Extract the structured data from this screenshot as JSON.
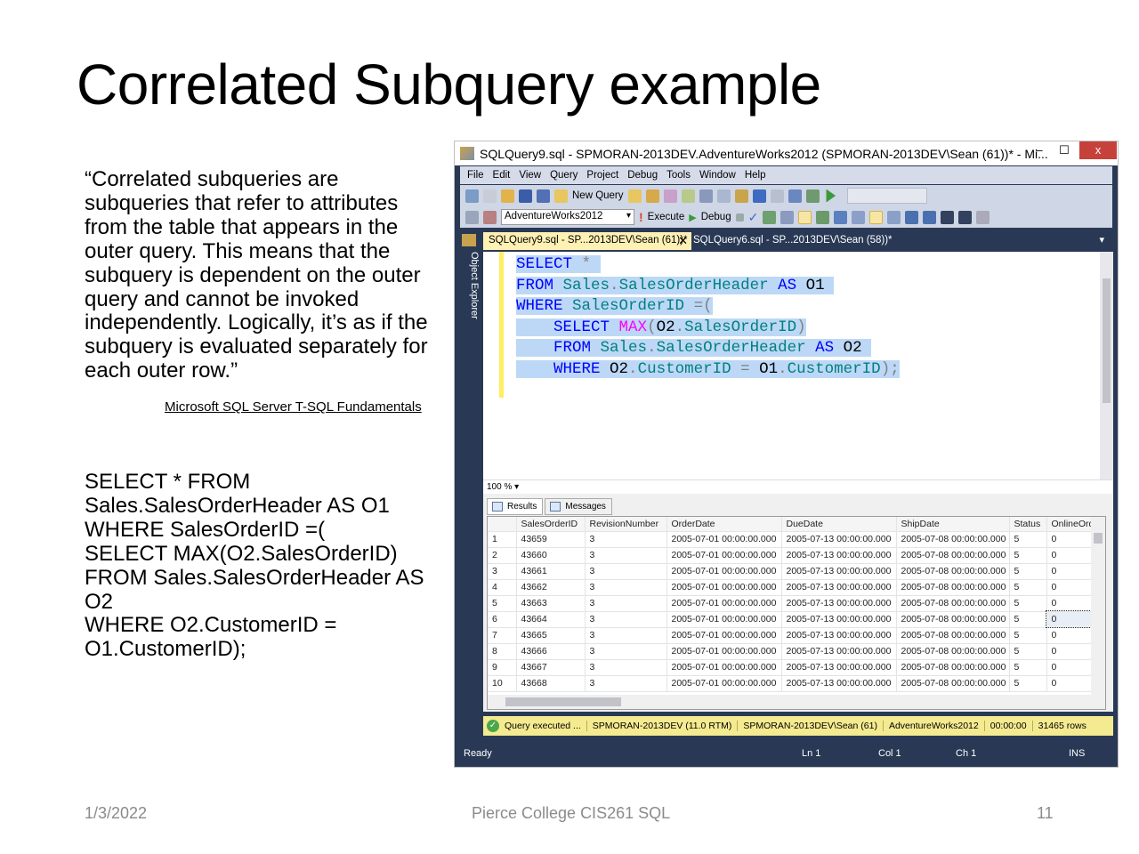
{
  "slide": {
    "title": "Correlated Subquery example",
    "quote": "“Correlated subqueries are subqueries that refer to attributes from the table that appears in the outer query. This means that the subquery is dependent on the outer query and cannot be invoked independently. Logically, it’s as if the subquery is evaluated separately for each outer row.”",
    "attribution": "Microsoft SQL Server T-SQL Fundamentals",
    "sql_lines": [
      "SELECT * FROM",
      "Sales.SalesOrderHeader AS O1",
      "WHERE SalesOrderID =(",
      "SELECT MAX(O2.SalesOrderID)",
      "FROM Sales.SalesOrderHeader AS",
      "O2",
      "WHERE O2.CustomerID =",
      "O1.CustomerID);"
    ],
    "footer": {
      "date": "1/3/2022",
      "center": "Pierce College CIS261 SQL",
      "page": "11"
    }
  },
  "ssms": {
    "window_title": "SQLQuery9.sql - SPMORAN-2013DEV.AdventureWorks2012 (SPMORAN-2013DEV\\Sean (61))* - Mi...",
    "window_buttons": {
      "minimize": "–",
      "maximize": "☐",
      "close": "x"
    },
    "menu": [
      "File",
      "Edit",
      "View",
      "Query",
      "Project",
      "Debug",
      "Tools",
      "Window",
      "Help"
    ],
    "toolbar": {
      "new_query": "New Query",
      "database": "AdventureWorks2012",
      "execute": "Execute",
      "debug": "Debug"
    },
    "object_explorer": "Object Explorer",
    "tabs": [
      {
        "label": "SQLQuery9.sql - SP...2013DEV\\Sean (61))*",
        "active": true
      },
      {
        "label": "SQLQuery6.sql - SP...2013DEV\\Sean (58))*",
        "active": false
      }
    ],
    "zoom": "100 %",
    "result_tabs": [
      "Results",
      "Messages"
    ],
    "columns": [
      "",
      "SalesOrderID",
      "RevisionNumber",
      "OrderDate",
      "DueDate",
      "ShipDate",
      "Status",
      "OnlineOrd"
    ],
    "rows": [
      [
        "1",
        "43659",
        "3",
        "2005-07-01 00:00:00.000",
        "2005-07-13 00:00:00.000",
        "2005-07-08 00:00:00.000",
        "5",
        "0"
      ],
      [
        "2",
        "43660",
        "3",
        "2005-07-01 00:00:00.000",
        "2005-07-13 00:00:00.000",
        "2005-07-08 00:00:00.000",
        "5",
        "0"
      ],
      [
        "3",
        "43661",
        "3",
        "2005-07-01 00:00:00.000",
        "2005-07-13 00:00:00.000",
        "2005-07-08 00:00:00.000",
        "5",
        "0"
      ],
      [
        "4",
        "43662",
        "3",
        "2005-07-01 00:00:00.000",
        "2005-07-13 00:00:00.000",
        "2005-07-08 00:00:00.000",
        "5",
        "0"
      ],
      [
        "5",
        "43663",
        "3",
        "2005-07-01 00:00:00.000",
        "2005-07-13 00:00:00.000",
        "2005-07-08 00:00:00.000",
        "5",
        "0"
      ],
      [
        "6",
        "43664",
        "3",
        "2005-07-01 00:00:00.000",
        "2005-07-13 00:00:00.000",
        "2005-07-08 00:00:00.000",
        "5",
        "0"
      ],
      [
        "7",
        "43665",
        "3",
        "2005-07-01 00:00:00.000",
        "2005-07-13 00:00:00.000",
        "2005-07-08 00:00:00.000",
        "5",
        "0"
      ],
      [
        "8",
        "43666",
        "3",
        "2005-07-01 00:00:00.000",
        "2005-07-13 00:00:00.000",
        "2005-07-08 00:00:00.000",
        "5",
        "0"
      ],
      [
        "9",
        "43667",
        "3",
        "2005-07-01 00:00:00.000",
        "2005-07-13 00:00:00.000",
        "2005-07-08 00:00:00.000",
        "5",
        "0"
      ],
      [
        "10",
        "43668",
        "3",
        "2005-07-01 00:00:00.000",
        "2005-07-13 00:00:00.000",
        "2005-07-08 00:00:00.000",
        "5",
        "0"
      ]
    ],
    "query_status": {
      "message": "Query executed ...",
      "server": "SPMORAN-2013DEV (11.0 RTM)",
      "login": "SPMORAN-2013DEV\\Sean (61)",
      "database": "AdventureWorks2012",
      "elapsed": "00:00:00",
      "rows": "31465 rows"
    },
    "status_bar": {
      "state": "Ready",
      "ln": "Ln 1",
      "col": "Col 1",
      "ch": "Ch 1",
      "mode": "INS"
    },
    "colors": {
      "navy": "#293955",
      "status_yellow": "#f4ea8f",
      "selection": "#bcd8f6",
      "keyword": "#0000ff"
    }
  }
}
